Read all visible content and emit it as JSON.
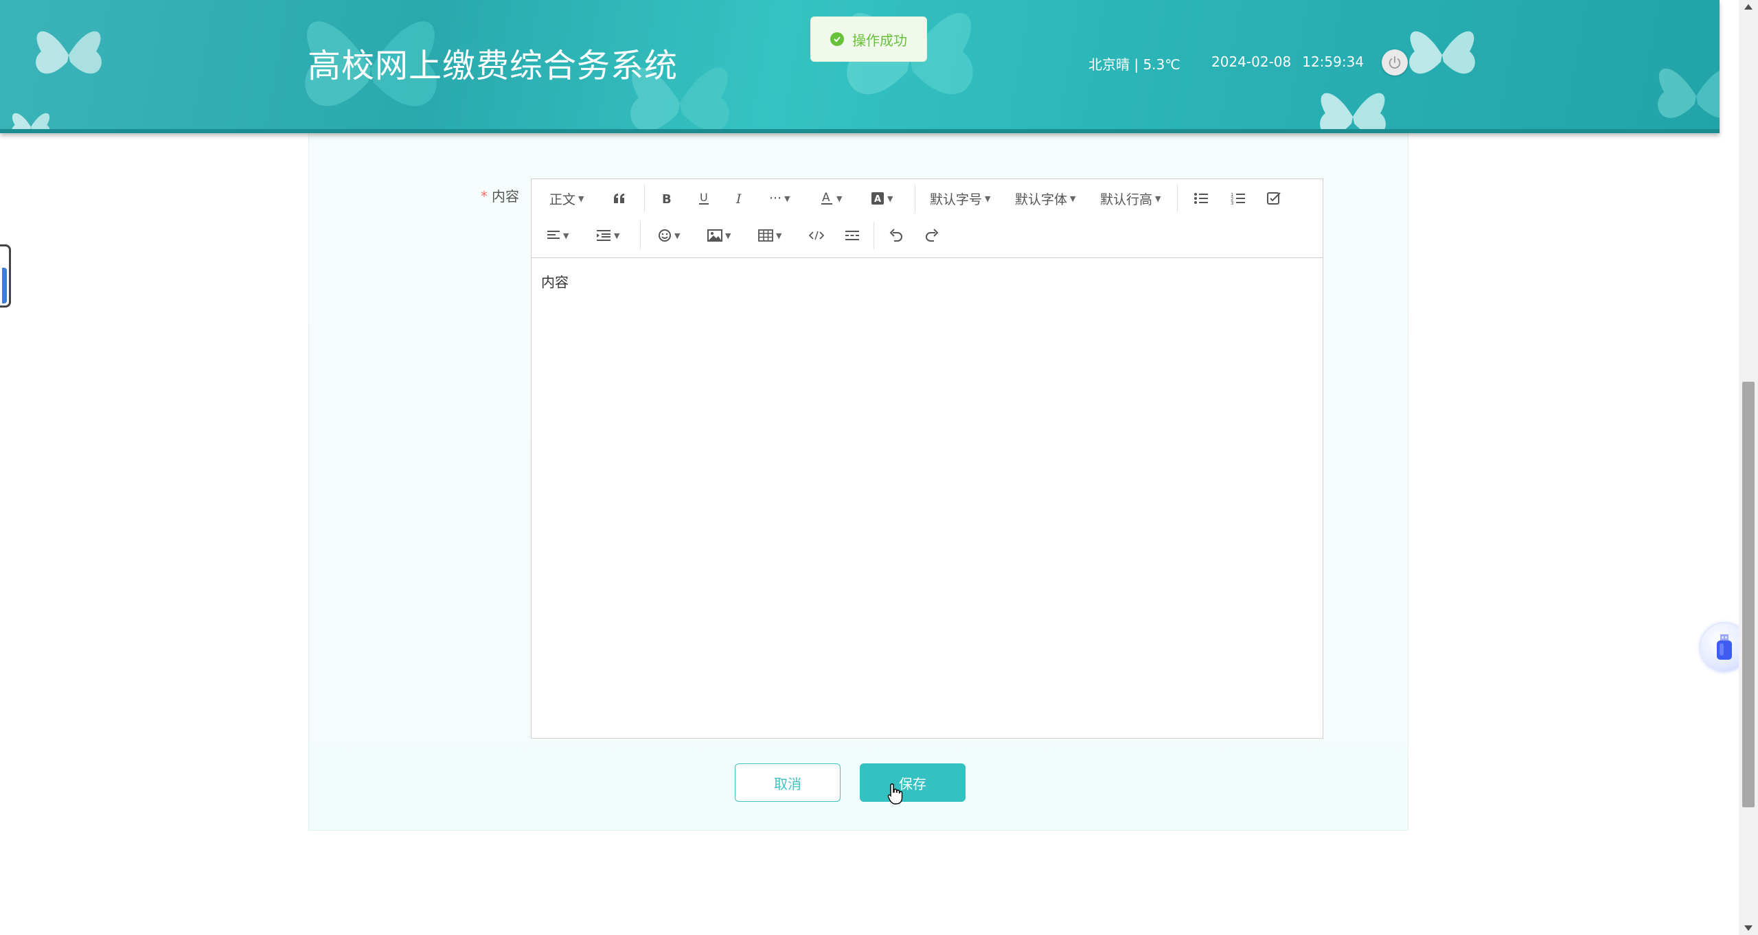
{
  "header": {
    "title": "高校网上缴费综合务系统",
    "weather": "北京晴 | 5.3℃",
    "date": "2024-02-08",
    "time": "12:59:34"
  },
  "toast": {
    "message": "操作成功"
  },
  "form": {
    "content_label": "内容",
    "required_mark": "*"
  },
  "editor": {
    "toolbar": {
      "paragraph": "正文",
      "font_size": "默认字号",
      "font_family": "默认字体",
      "line_height": "默认行高",
      "more": "···"
    },
    "body_text": "内容"
  },
  "buttons": {
    "cancel": "取消",
    "save": "保存"
  },
  "colors": {
    "header": "#2aa9ad",
    "accent": "#33c1c1",
    "success": "#67c23a",
    "required": "#f56c6c"
  }
}
